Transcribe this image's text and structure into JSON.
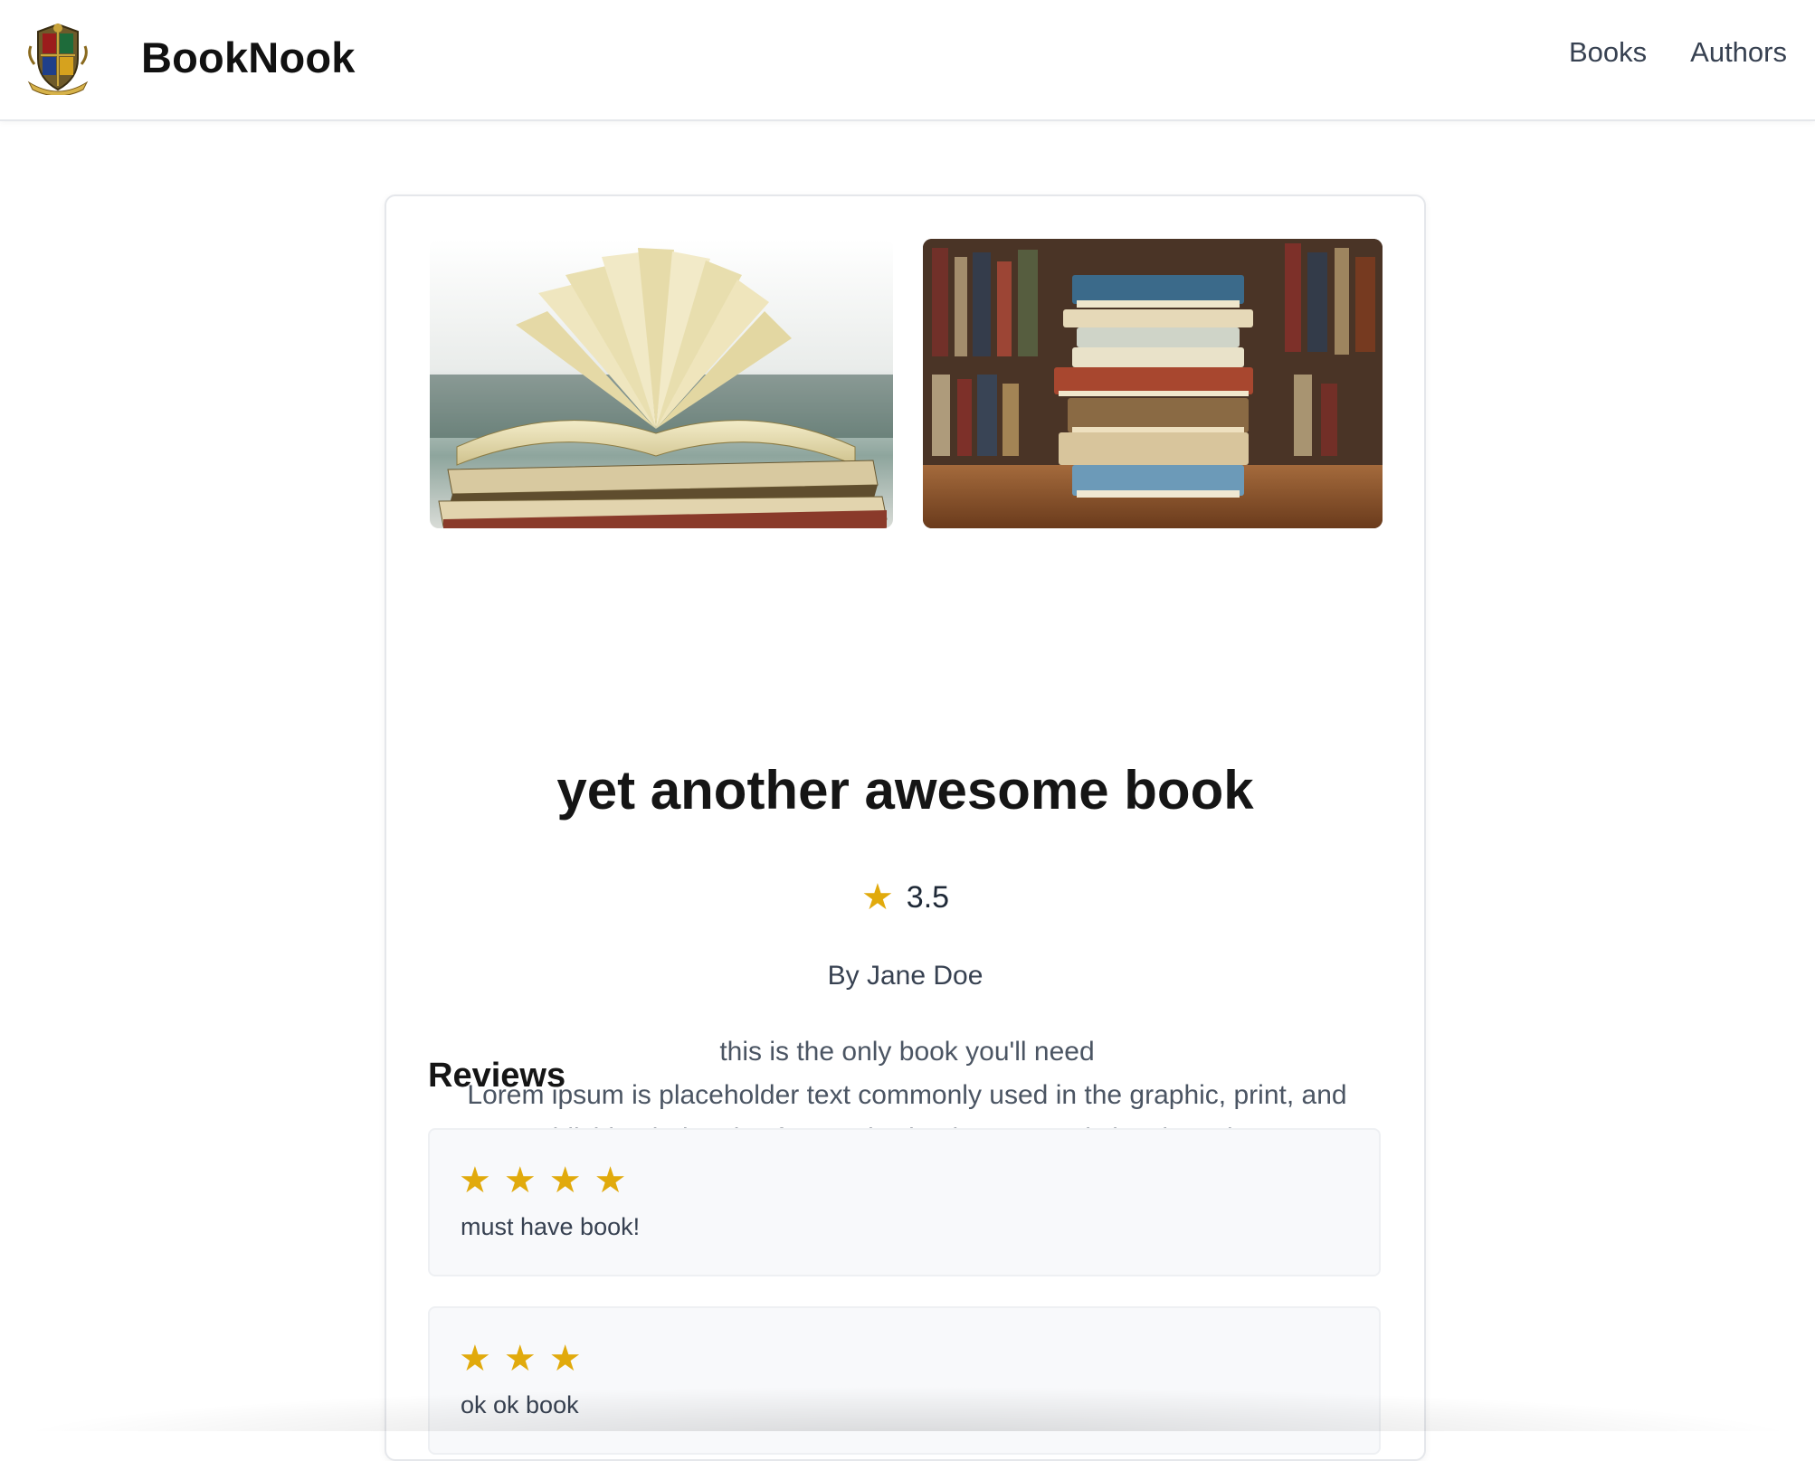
{
  "header": {
    "brand_name": "BookNook",
    "logo_icon": "crest-logo-icon",
    "nav": [
      {
        "label": "Books"
      },
      {
        "label": "Authors"
      }
    ]
  },
  "book": {
    "images": [
      {
        "icon": "open-book-image"
      },
      {
        "icon": "book-stack-image"
      }
    ],
    "title": "yet another awesome book",
    "rating": "3.5",
    "rating_icon": "star-icon",
    "author_line": "By Jane Doe",
    "description_line1": "this is the only book you'll need",
    "description_line2": "Lorem ipsum is placeholder text commonly used in the graphic, print, and publishing industries for previewing layouts and visual mockups."
  },
  "reviews": {
    "heading": "Reviews",
    "items": [
      {
        "stars": 4,
        "text": "must have book!"
      },
      {
        "stars": 3,
        "text": "ok ok book"
      }
    ]
  },
  "colors": {
    "star": "#e1aa0c",
    "text": "#1f2937",
    "muted": "#4b5563",
    "review_bg": "#f8f9fb"
  }
}
